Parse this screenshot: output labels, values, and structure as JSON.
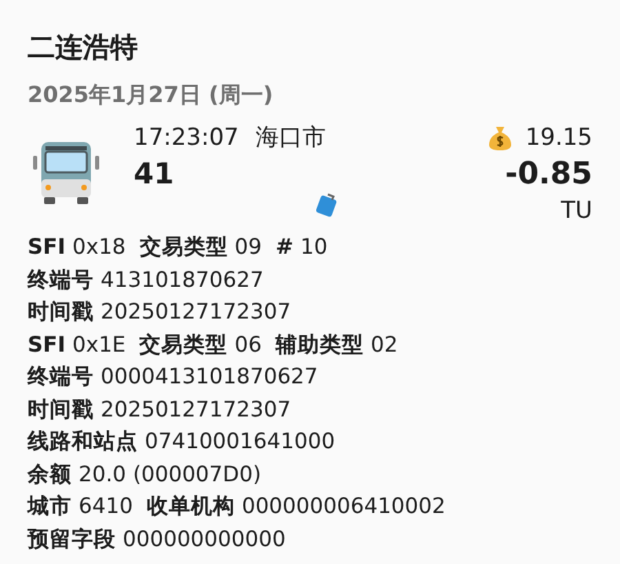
{
  "title": "二连浩特",
  "date": "2025年1月27日 (周一)",
  "trip": {
    "time": "17:23:07",
    "city": "海口市",
    "route": "41",
    "balance": "19.15",
    "amount": "-0.85",
    "currency": "TU"
  },
  "records": [
    {
      "fields": [
        {
          "label": "SFI",
          "value": "0x18"
        },
        {
          "label": "交易类型",
          "value": "09"
        },
        {
          "label": "#",
          "value": "10"
        }
      ]
    },
    {
      "fields": [
        {
          "label": "终端号",
          "value": "413101870627"
        }
      ]
    },
    {
      "fields": [
        {
          "label": "时间戳",
          "value": "20250127172307"
        }
      ]
    },
    {
      "fields": [
        {
          "label": "SFI",
          "value": "0x1E"
        },
        {
          "label": "交易类型",
          "value": "06"
        },
        {
          "label": "辅助类型",
          "value": "02"
        }
      ]
    },
    {
      "fields": [
        {
          "label": "终端号",
          "value": "0000413101870627"
        }
      ]
    },
    {
      "fields": [
        {
          "label": "时间戳",
          "value": "20250127172307"
        }
      ]
    },
    {
      "fields": [
        {
          "label": "线路和站点",
          "value": "07410001641000"
        }
      ]
    },
    {
      "fields": [
        {
          "label": "余额",
          "value": "20.0 (000007D0)"
        }
      ]
    },
    {
      "fields": [
        {
          "label": "城市",
          "value": "6410"
        },
        {
          "label": "收单机构",
          "value": "000000006410002"
        }
      ]
    },
    {
      "fields": [
        {
          "label": "预留字段",
          "value": "000000000000"
        }
      ]
    }
  ]
}
